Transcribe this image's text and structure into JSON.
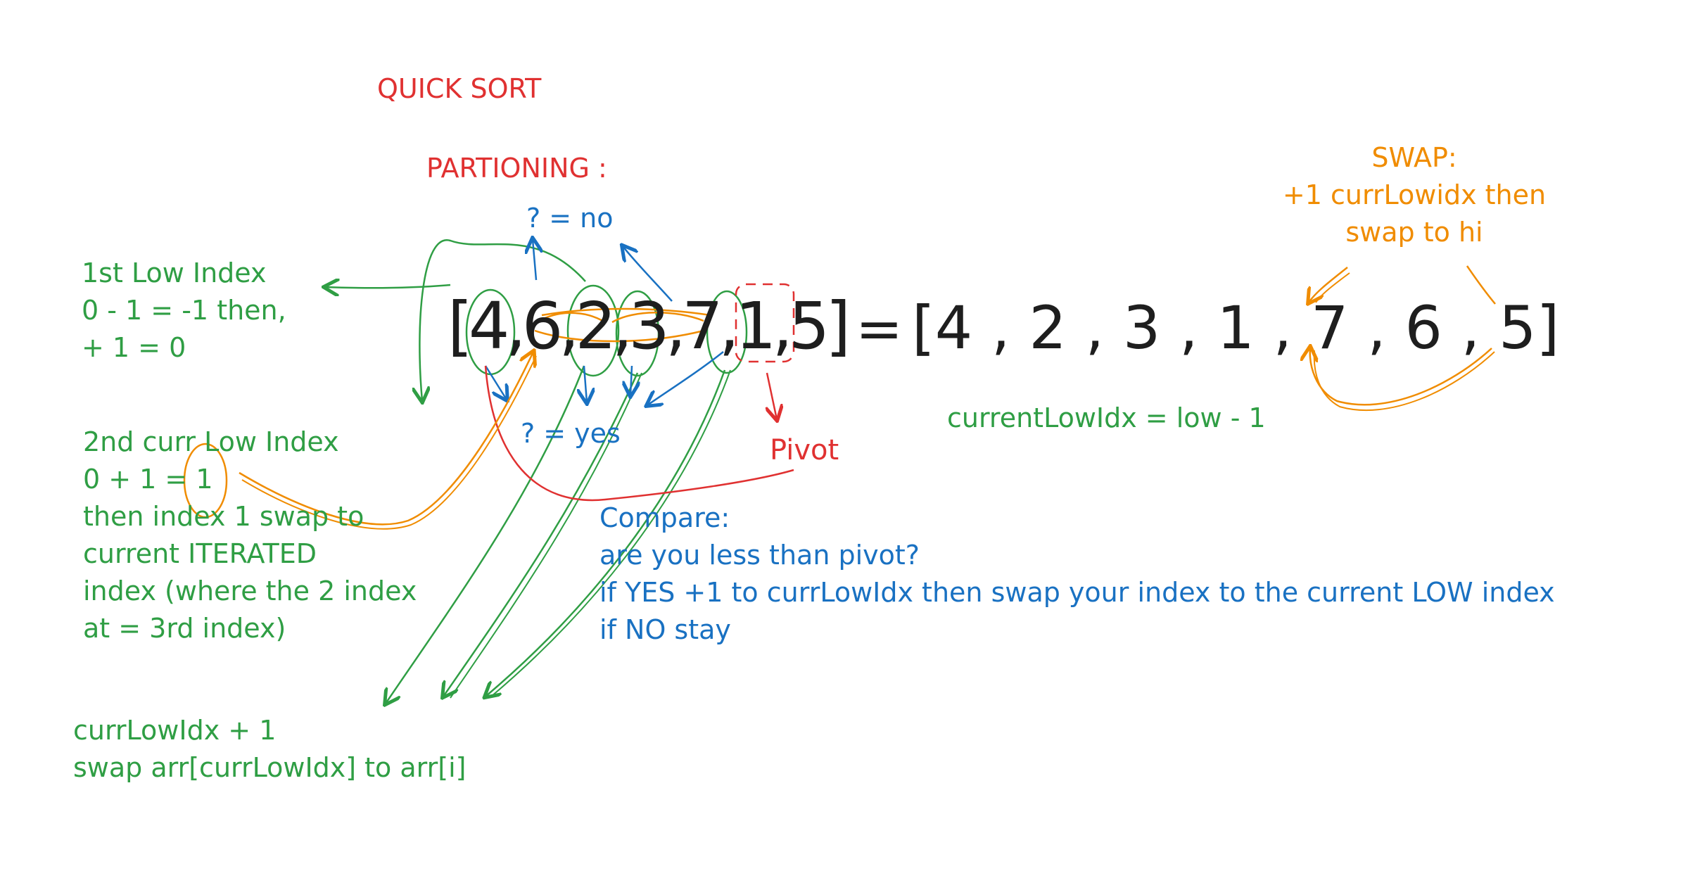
{
  "title": "QUICK SORT",
  "subtitle": "PARTIONING :",
  "array_left": {
    "open": "[",
    "items": [
      "4",
      "6",
      "2",
      "3",
      "7",
      "1",
      "5"
    ],
    "separator": ",",
    "close": "]"
  },
  "equals": "=",
  "array_result": "[4 , 2 , 3 , 1 , 7 , 6 , 5]",
  "q_no": "? = no",
  "q_yes": "? = yes",
  "pivot_label": "Pivot",
  "current_low_idx": "currentLowIdx = low - 1",
  "first_low": [
    "1st Low Index",
    "0 - 1 = -1 then,",
    "+ 1 = 0"
  ],
  "second_low": [
    "2nd curr Low Index",
    "0 + 1 = 1",
    "then index 1 swap to",
    "current ITERATED",
    "index (where the 2 index",
    "at = 3rd index)"
  ],
  "compare": [
    "Compare:",
    "are you less than pivot?",
    "if YES +1 to currLowIdx then swap your index to the current LOW index",
    "if NO stay"
  ],
  "curr_low_plus": [
    "currLowIdx + 1",
    "swap arr[currLowIdx] to arr[i]"
  ],
  "swap_note": [
    "SWAP:",
    "+1 currLowidx then",
    "swap to hi"
  ],
  "colors": {
    "red": "#e03131",
    "green": "#2f9e44",
    "blue": "#1971c2",
    "orange": "#f08c00",
    "black": "#1e1e1e"
  }
}
